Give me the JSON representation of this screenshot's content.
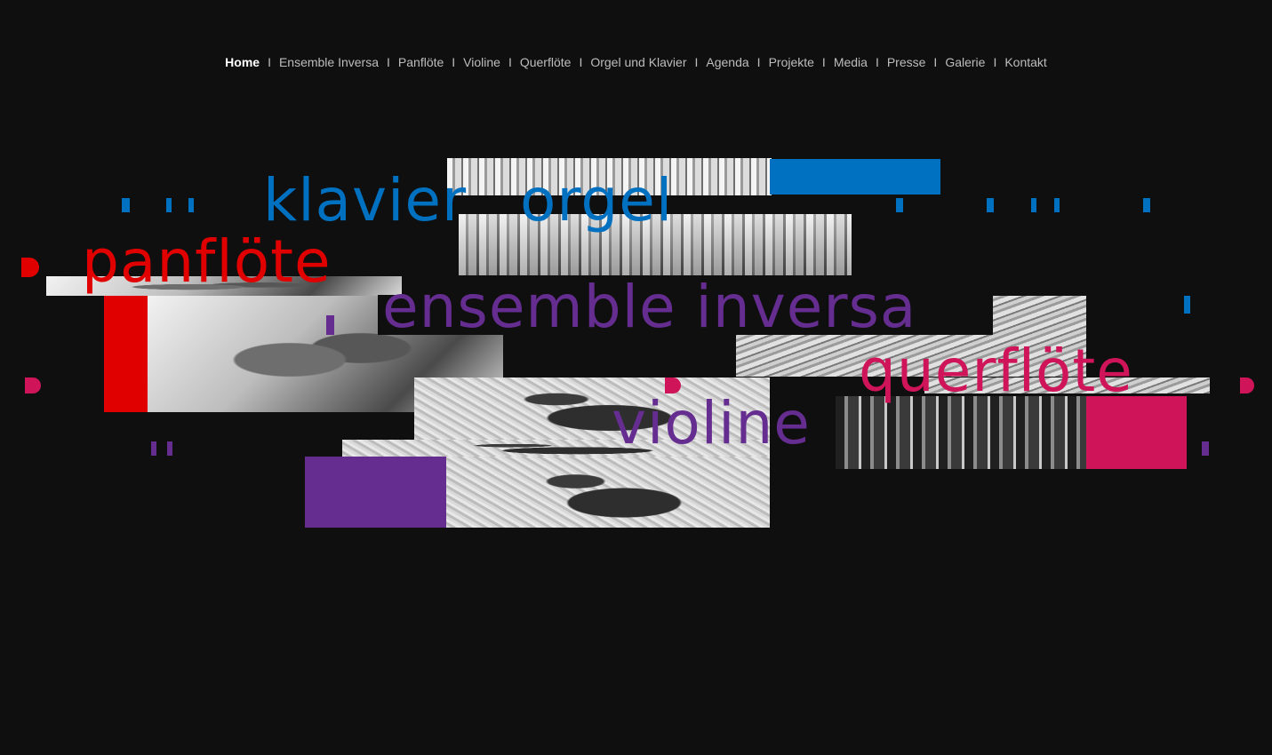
{
  "nav": {
    "items": [
      {
        "label": "Home",
        "active": true
      },
      {
        "label": "Ensemble Inversa"
      },
      {
        "label": "Panflöte"
      },
      {
        "label": "Violine"
      },
      {
        "label": "Querflöte"
      },
      {
        "label": "Orgel und Klavier"
      },
      {
        "label": "Agenda"
      },
      {
        "label": "Projekte"
      },
      {
        "label": "Media"
      },
      {
        "label": "Presse"
      },
      {
        "label": "Galerie"
      },
      {
        "label": "Kontakt"
      }
    ],
    "separator": "I"
  },
  "collage": {
    "words": {
      "klavier": "klavier",
      "orgel": "orgel",
      "panfloete": "panflöte",
      "ensemble": "ensemble inversa",
      "querfloete": "querflöte",
      "violine": "violine"
    }
  },
  "colors": {
    "background": "#0f0f10",
    "blue": "#0070c0",
    "red": "#e00000",
    "magenta": "#d0145a",
    "purple": "#662d91",
    "nav_text": "#bdbdbd",
    "nav_active": "#ffffff"
  }
}
